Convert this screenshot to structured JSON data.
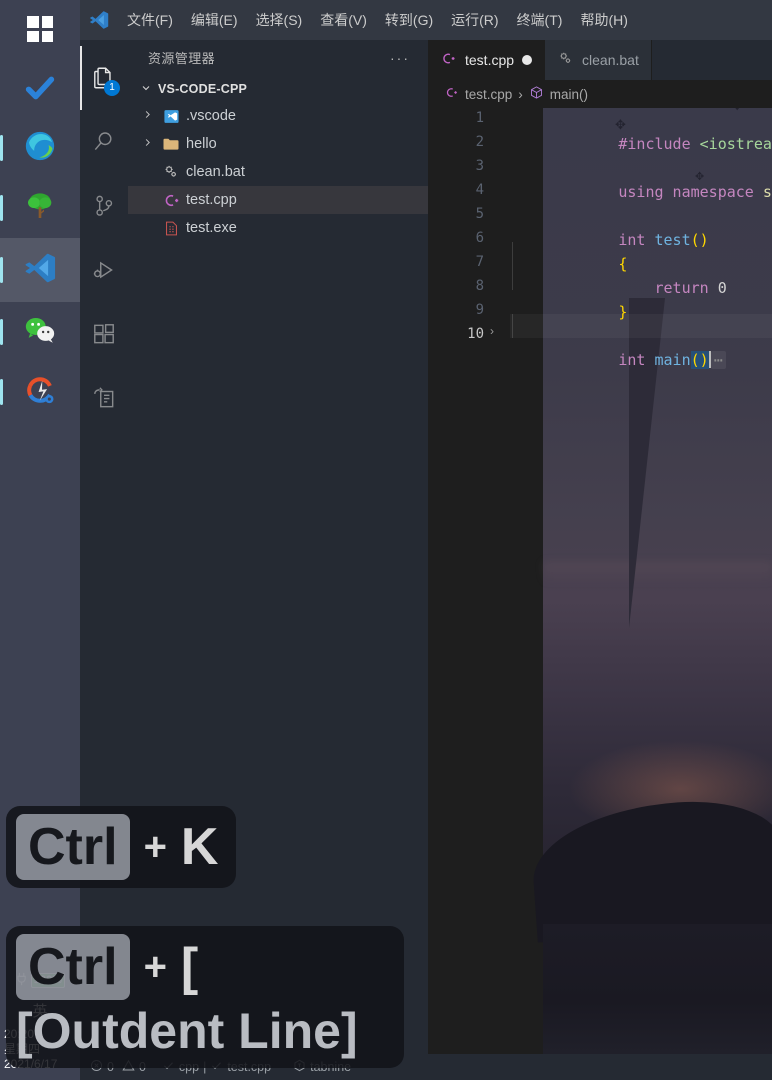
{
  "taskbar": {
    "icons": [
      {
        "name": "windows-start-icon",
        "label": "Start"
      },
      {
        "name": "checkmark-icon",
        "label": "To Do"
      },
      {
        "name": "edge-browser-icon",
        "label": "Microsoft Edge"
      },
      {
        "name": "tree-app-icon",
        "label": "Tree App"
      },
      {
        "name": "vscode-icon",
        "label": "Visual Studio Code"
      },
      {
        "name": "wechat-icon",
        "label": "WeChat"
      },
      {
        "name": "tools-icon",
        "label": "Tools"
      }
    ],
    "tray": {
      "battery_percent": "100%",
      "ime": "英",
      "time": "20:20",
      "weekday": "星期四",
      "date": "2021/6/17"
    }
  },
  "menubar": {
    "items": [
      {
        "label": "文件(F)"
      },
      {
        "label": "编辑(E)"
      },
      {
        "label": "选择(S)"
      },
      {
        "label": "查看(V)"
      },
      {
        "label": "转到(G)"
      },
      {
        "label": "运行(R)"
      },
      {
        "label": "终端(T)"
      },
      {
        "label": "帮助(H)"
      }
    ]
  },
  "activitybar": {
    "items": [
      {
        "name": "explorer-icon",
        "label": "资源管理器",
        "badge": "1"
      },
      {
        "name": "search-icon",
        "label": "搜索",
        "badge": ""
      },
      {
        "name": "source-control-icon",
        "label": "源代码管理",
        "badge": ""
      },
      {
        "name": "run-debug-icon",
        "label": "运行和调试",
        "badge": ""
      },
      {
        "name": "extensions-icon",
        "label": "扩展",
        "badge": ""
      },
      {
        "name": "remote-explorer-icon",
        "label": "远程资源管理器",
        "badge": ""
      }
    ]
  },
  "sidebar": {
    "title": "资源管理器",
    "more_actions": "···",
    "root_label": "VS-CODE-CPP",
    "root_chevron": "⌄",
    "items": [
      {
        "label": ".vscode",
        "type": "folder",
        "icon": "vscode-folder-icon",
        "chevron": "›",
        "selected": false
      },
      {
        "label": "hello",
        "type": "folder",
        "icon": "folder-icon",
        "chevron": "›",
        "selected": false
      },
      {
        "label": "clean.bat",
        "type": "file",
        "icon": "bat-file-icon",
        "chevron": "",
        "selected": false
      },
      {
        "label": "test.cpp",
        "type": "file",
        "icon": "cpp-file-icon",
        "chevron": "",
        "selected": true
      },
      {
        "label": "test.exe",
        "type": "file",
        "icon": "exe-file-icon",
        "chevron": "",
        "selected": false
      }
    ]
  },
  "editor": {
    "tabs": [
      {
        "label": "test.cpp",
        "icon": "cpp-file-icon",
        "active": true,
        "dirty": true
      },
      {
        "label": "clean.bat",
        "icon": "bat-file-icon",
        "active": false,
        "dirty": false
      }
    ],
    "breadcrumb": {
      "file": "test.cpp",
      "separator": "›",
      "symbol": "main()"
    },
    "line_numbers": [
      "1",
      "2",
      "3",
      "4",
      "5",
      "6",
      "7",
      "8",
      "9",
      "10"
    ],
    "fold_marker": "›",
    "fold_ellipsis": "⋯",
    "code": {
      "l1_include": "#include",
      "l1_header": "<iostream>",
      "l3_using": "using namespace",
      "l3_std": "std;",
      "l5_int": "int",
      "l5_name": "test",
      "l5_parens": "()",
      "l6_brace": "{",
      "l7_return": "return",
      "l7_zero": "0",
      "l8_brace": "}",
      "l10_int": "int",
      "l10_name": "main",
      "l10_parens": "()"
    }
  },
  "statusbar": {
    "errors": "0",
    "warnings": "0",
    "language_check": "cpp",
    "divider": "|",
    "file_check": "test.cpp",
    "tabnine": "tabnine"
  },
  "key_overlays": [
    {
      "modifier": "Ctrl",
      "plus": "+",
      "key": "K",
      "description": ""
    },
    {
      "modifier": "Ctrl",
      "plus": "+",
      "key": "[",
      "description": "[Outdent Line]"
    }
  ],
  "colors": {
    "accent": "#0078d4",
    "selection": "#264f78",
    "sidebar_bg": "#252a33",
    "editor_bg": "#1e1e1e",
    "battery_green": "#17a81a"
  }
}
